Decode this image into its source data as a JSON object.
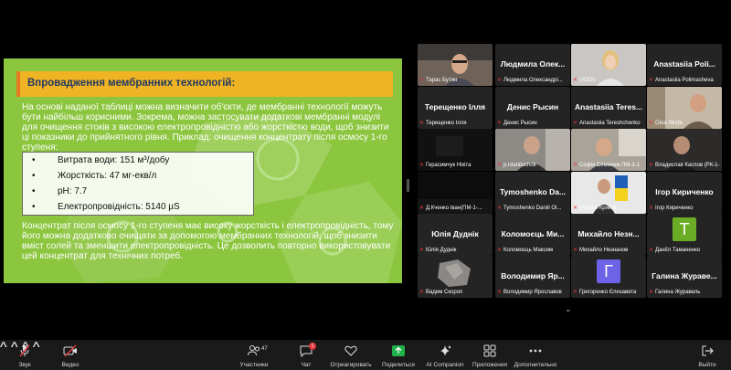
{
  "slide": {
    "title": "Впровадження мембранних технологій:",
    "paragraph1": "На основі наданої таблиці можна визначити об'єкти, де мембранні технології можуть бути найбільш корисними. Зокрема, можна застосувати додаткові мембранні модулі для очищення стоків з високою електропровідністю або жорсткістю води, щоб знизити ці показники до прийнятного рівня. Приклад: очищення концентрату після осмосу 1-го ступеня:",
    "bullets": [
      "Витрата води: 151 м³/добу",
      "Жорсткість: 47 мг-екв/л",
      "pH: 7.7",
      "Електропровідність: 5140 µS"
    ],
    "paragraph2": "Концентрат після осмосу 1-го ступеня має високу жорсткість і електропровідність, тому його можна додатково очищати за допомогою мембранних технологій, щоб знизити вміст солей та зменшити електропровідність. Це дозволить повторно використовувати цей концентрат для технічних потреб."
  },
  "participants": [
    {
      "name": "",
      "caption": "Тарас Бутин",
      "video": "man-glasses"
    },
    {
      "name": "Людмила Олек...",
      "caption": "Людмила Олександрі...",
      "video": ""
    },
    {
      "name": "",
      "caption": "UGEN",
      "video": "woman-blonde"
    },
    {
      "name": "Anastasiia Poli...",
      "caption": "Anastasiia Polimasheva",
      "video": ""
    },
    {
      "name": "Терещенко Ілля",
      "caption": "Терещенко Ілля",
      "video": ""
    },
    {
      "name": "Денис Рысин",
      "caption": "Денис Рысин",
      "video": ""
    },
    {
      "name": "Anastasiia Teres...",
      "caption": "Anastasiia Tereshchenko",
      "video": ""
    },
    {
      "name": "",
      "caption": "Gina Skofa",
      "video": "man-room"
    },
    {
      "name": "",
      "caption": "Герасимчук Нікіта",
      "video": "dark"
    },
    {
      "name": "",
      "caption": "p.rdanilochok",
      "video": "man-office"
    },
    {
      "name": "",
      "caption": "Софія Семенюк ПМ-2-1",
      "video": "man-window"
    },
    {
      "name": "",
      "caption": "Владислав Каспов (РК-1-...",
      "video": "man-dark-room"
    },
    {
      "name": "",
      "caption": "Д.Кченко Іван(ПМ-1-...",
      "video": "dark-screen"
    },
    {
      "name": "Tymoshenko Da...",
      "caption": "Tymoshenko Daniil Ol...",
      "video": ""
    },
    {
      "name": "",
      "caption": "Руслан Криков",
      "video": "flag"
    },
    {
      "name": "Ігор Кириченко",
      "caption": "Ігор Кириченко",
      "video": ""
    },
    {
      "name": "Юлія Дуднік",
      "caption": "Юлія Дуднік",
      "video": ""
    },
    {
      "name": "Коломоєць Ми...",
      "caption": "Коломоєць Максим",
      "video": ""
    },
    {
      "name": "Михайло Незн...",
      "caption": "Михайло Незнанов",
      "video": ""
    },
    {
      "name": "",
      "caption": "Даніїл Таманенко",
      "video": "letter-T"
    },
    {
      "name": "",
      "caption": "Вадим Скороп",
      "video": "rock"
    },
    {
      "name": "Володимир Яр...",
      "caption": "Володимир Ярославов",
      "video": ""
    },
    {
      "name": "",
      "caption": "Григоренко Єлизавета",
      "video": "letter-G"
    },
    {
      "name": "Галина Жураве...",
      "caption": "Галина Журавель",
      "video": ""
    }
  ],
  "avatars": {
    "T": "T",
    "G": "Г"
  },
  "toolbar": {
    "audio": "Звук",
    "video": "Видео",
    "participants": "Участники",
    "participants_count": "47",
    "chat": "Чат",
    "chat_badge": "1",
    "react": "Отреагировать",
    "share": "Поделиться",
    "ai": "AI Companion",
    "apps": "Приложения",
    "more": "Дополнительно",
    "leave": "Выйти"
  },
  "colors": {
    "slide_bg": "#8cc63f",
    "title_bg": "#f0b323",
    "title_text": "#1f3a64",
    "share_green": "#20b14a",
    "mic_off_red": "#e0383e",
    "speaking_green": "#3ddb4b",
    "avatar_T": "#6aad24",
    "avatar_G": "#6d63e6"
  }
}
